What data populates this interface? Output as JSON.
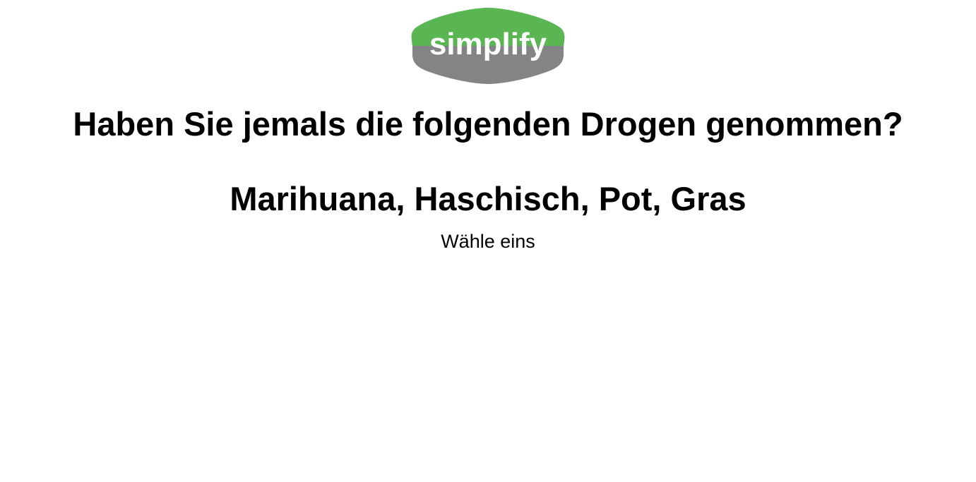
{
  "logo": {
    "text": "simplify",
    "top_color": "#5ab652",
    "bottom_color": "#838486"
  },
  "survey": {
    "question": "Haben Sie jemals die folgenden Drogen genommen?",
    "item": "Marihuana, Haschisch, Pot, Gras",
    "instruction": "Wähle eins"
  }
}
